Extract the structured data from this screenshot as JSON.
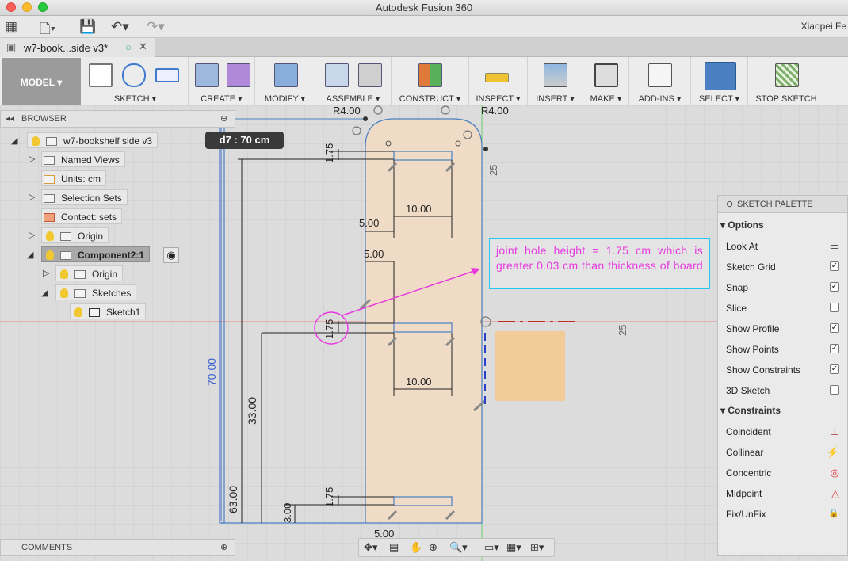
{
  "window": {
    "title": "Autodesk Fusion 360",
    "user": "Xiaopei Fe"
  },
  "tab": {
    "name": "w7-book...side v3*"
  },
  "workspace": {
    "label": "MODEL ▾"
  },
  "toolbar": {
    "groups": [
      {
        "label": "SKETCH ▾"
      },
      {
        "label": "CREATE ▾"
      },
      {
        "label": "MODIFY ▾"
      },
      {
        "label": "ASSEMBLE ▾"
      },
      {
        "label": "CONSTRUCT ▾"
      },
      {
        "label": "INSPECT ▾"
      },
      {
        "label": "INSERT ▾"
      },
      {
        "label": "MAKE ▾"
      },
      {
        "label": "ADD-INS ▾"
      },
      {
        "label": "SELECT ▾"
      },
      {
        "label": "STOP SKETCH"
      }
    ]
  },
  "browser": {
    "title": "BROWSER",
    "items": [
      {
        "label": "w7-bookshelf side v3"
      },
      {
        "label": "Named Views"
      },
      {
        "label": "Units: cm"
      },
      {
        "label": "Selection Sets"
      },
      {
        "label": "Contact: sets"
      },
      {
        "label": "Origin"
      },
      {
        "label": "Component2:1"
      },
      {
        "label": "Origin"
      },
      {
        "label": "Sketches"
      },
      {
        "label": "Sketch1"
      }
    ]
  },
  "comments": {
    "title": "COMMENTS"
  },
  "tooltip": {
    "text": "d7 : 70 cm"
  },
  "note": {
    "text": "joint hole height = 1.75 cm which is greater 0.03 cm than thickness of board"
  },
  "dimensions": {
    "r_left": "R4.00",
    "r_right": "R4.00",
    "d175a": "1.75",
    "d175b": "1.75",
    "d175c": "1.75",
    "d1000a": "10.00",
    "d1000b": "10.00",
    "d500a": "5.00",
    "d500b": "5.00",
    "d500c": "5.00",
    "d25a": "25",
    "d25b": "25",
    "d7000": "70.00",
    "d3300": "33.00",
    "d6300": "63.00",
    "d300": "3.00"
  },
  "palette": {
    "title": "SKETCH PALETTE",
    "options_title": "Options",
    "options": [
      {
        "label": "Look At",
        "type": "icon",
        "icon": "look-at-icon"
      },
      {
        "label": "Sketch Grid",
        "type": "check",
        "checked": "✓"
      },
      {
        "label": "Snap",
        "type": "check",
        "checked": "✓"
      },
      {
        "label": "Slice",
        "type": "check",
        "checked": ""
      },
      {
        "label": "Show Profile",
        "type": "check",
        "checked": "✓"
      },
      {
        "label": "Show Points",
        "type": "check",
        "checked": "✓"
      },
      {
        "label": "Show Constraints",
        "type": "check",
        "checked": "✓"
      },
      {
        "label": "3D Sketch",
        "type": "check",
        "checked": ""
      }
    ],
    "constraints_title": "Constraints",
    "constraints": [
      {
        "label": "Coincident",
        "glyph": "⊥"
      },
      {
        "label": "Collinear",
        "glyph": "⚡"
      },
      {
        "label": "Concentric",
        "glyph": "◎"
      },
      {
        "label": "Midpoint",
        "glyph": "△"
      },
      {
        "label": "Fix/UnFix",
        "glyph": "🔒"
      }
    ]
  },
  "colors": {
    "accent": "#4a7fc1",
    "highlight": "#f0c080",
    "note": "#e839e0"
  }
}
